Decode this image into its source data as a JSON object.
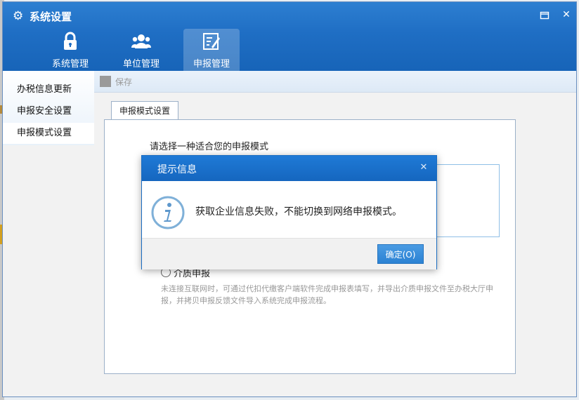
{
  "window": {
    "title": "系统设置"
  },
  "nav_tabs": [
    {
      "label": "系统管理",
      "icon": "lock-icon"
    },
    {
      "label": "单位管理",
      "icon": "users-icon"
    },
    {
      "label": "申报管理",
      "icon": "edit-form-icon"
    }
  ],
  "sidebar": {
    "items": [
      {
        "label": "办税信息更新"
      },
      {
        "label": "申报安全设置"
      },
      {
        "label": "申报模式设置",
        "selected": true
      }
    ]
  },
  "toolbar": {
    "save_label": "保存"
  },
  "content": {
    "tab_label": "申报模式设置",
    "prompt": "请选择一种适合您的申报模式",
    "offline_option_label": "介质申报",
    "offline_option_desc": "未连接互联网时，可通过代扣代缴客户端软件完成申报表填写，并导出介质申报文件至办税大厅申报，并拷贝申报反馈文件导入系统完成申报流程。"
  },
  "dialog": {
    "title": "提示信息",
    "message": "获取企业信息失败，不能切换到网络申报模式。",
    "ok_label": "确定(O)",
    "icon": "info-icon"
  },
  "colors": {
    "header_blue": "#1f6ec4",
    "dialog_head_blue": "#1a6cc0",
    "ok_button_blue": "#2b82d3"
  }
}
